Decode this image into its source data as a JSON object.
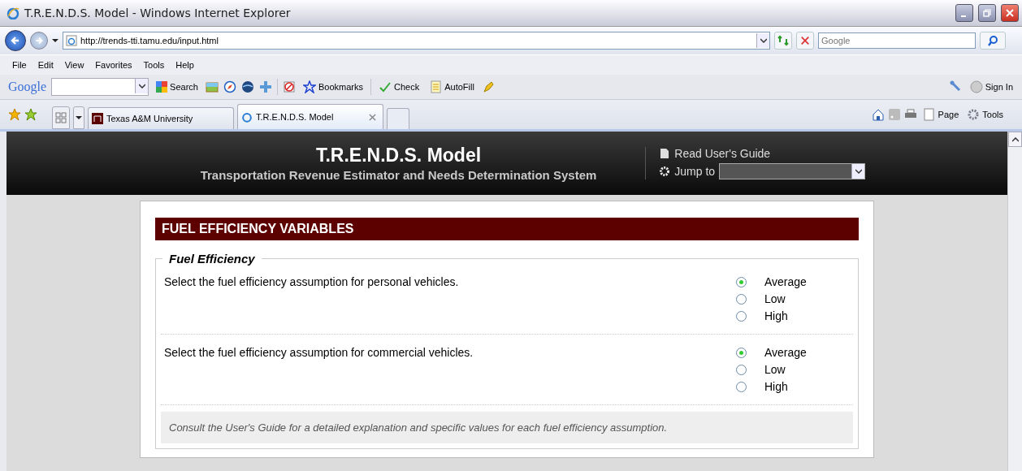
{
  "window": {
    "title": "T.R.E.N.D.S. Model - Windows Internet Explorer"
  },
  "address_bar": {
    "url": "http://trends-tti.tamu.edu/input.html",
    "search_placeholder": "Google"
  },
  "menu": [
    "File",
    "Edit",
    "View",
    "Favorites",
    "Tools",
    "Help"
  ],
  "google_toolbar": {
    "logo": "Google",
    "search": "Search",
    "bookmarks": "Bookmarks",
    "check": "Check",
    "autofill": "AutoFill",
    "sign_in": "Sign In"
  },
  "tabs": [
    {
      "label": "Texas A&M University",
      "selected": false
    },
    {
      "label": "T.R.E.N.D.S. Model",
      "selected": true
    }
  ],
  "command_bar": {
    "page": "Page",
    "tools": "Tools"
  },
  "header": {
    "title": "T.R.E.N.D.S. Model",
    "subtitle": "Transportation Revenue Estimator and Needs Determination System",
    "guide_link": "Read User's Guide",
    "jump_label": "Jump to"
  },
  "section": {
    "title": "FUEL EFFICIENCY VARIABLES",
    "legend": "Fuel Efficiency",
    "questions": [
      {
        "text": "Select the fuel efficiency assumption for personal vehicles.",
        "options": [
          {
            "label": "Average",
            "selected": true
          },
          {
            "label": "Low",
            "selected": false
          },
          {
            "label": "High",
            "selected": false
          }
        ]
      },
      {
        "text": "Select the fuel efficiency assumption for commercial vehicles.",
        "options": [
          {
            "label": "Average",
            "selected": true
          },
          {
            "label": "Low",
            "selected": false
          },
          {
            "label": "High",
            "selected": false
          }
        ]
      }
    ],
    "note": "Consult the User's Guide for a detailed explanation and specific values for each fuel efficiency assumption."
  }
}
